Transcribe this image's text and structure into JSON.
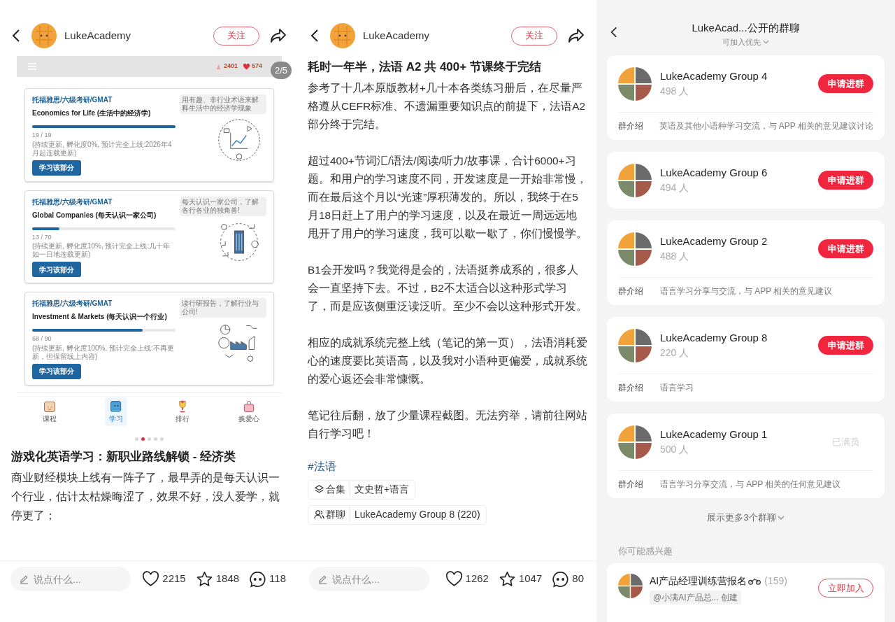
{
  "left": {
    "author": "LukeAcademy",
    "follow": "关注",
    "slide": {
      "counter": "2/5",
      "stats": [
        {
          "kind": "xp",
          "value": "2401"
        },
        {
          "kind": "heart",
          "value": "574"
        }
      ],
      "courses": [
        {
          "tag": "托福雅思/六级考研/GMAT",
          "title": "Economics for Life (生活中的经济学)",
          "bubble": "用有趣、非行业术语来解释生活中的经济学现象",
          "level": 1,
          "count": "19 / 19",
          "note": "(持续更新, 孵化度0%, 预计完全上线:2026年4月起连载更新)",
          "button": "学习该部分",
          "kind": "economy"
        },
        {
          "tag": "托福雅思/六级考研/GMAT",
          "title": "Global Companies (每天认识一家公司)",
          "bubble": "每天认识一家公司，了解各行各业的独角兽!",
          "level": 0.19,
          "count": "13 / 70",
          "note": "(持续更新, 孵化度10%, 预计完全上线:几十年如一日地连载更新)",
          "button": "学习该部分",
          "kind": "company"
        },
        {
          "tag": "托福雅思/六级考研/GMAT",
          "title": "Investment & Markets (每天认识一个行业)",
          "bubble": "读行研报告，了解行业与公司!",
          "level": 0.77,
          "count": "68 / 90",
          "note": "(持续更新, 孵化度100%, 预计完全上线:不再更新，但保留线上内容)",
          "button": "学习该部分",
          "kind": "industry"
        }
      ],
      "tabs": [
        {
          "label": "课程",
          "selected": false,
          "kind": "course"
        },
        {
          "label": "学习",
          "selected": true,
          "kind": "book"
        },
        {
          "label": "排行",
          "selected": false,
          "kind": "trophy"
        },
        {
          "label": "换爱心",
          "selected": false,
          "kind": "bag"
        }
      ]
    },
    "dots": [
      {
        "selected": false
      },
      {
        "selected": true
      },
      {
        "selected": false
      },
      {
        "selected": false
      },
      {
        "selected": false
      }
    ],
    "title": "游戏化英语学习：新职业路线解锁 - 经济类",
    "body": "商业财经模块上线有一阵子了，最早弄的是每天认识一个行业，估计太枯燥晦涩了，效果不好，没人爱学，就停更了；",
    "bar": {
      "placeholder": "说点什么...",
      "likes": "2215",
      "stars": "1848",
      "comments": "118"
    }
  },
  "middle": {
    "author": "LukeAcademy",
    "follow": "关注",
    "title": "耗时一年半，法语 A2 共 400+ 节课终于完结",
    "paragraphs": [
      "参考了十几本原版教材+几十本各类练习册后，在尽量严格遵从CEFR标准、不遗漏重要知识点的前提下，法语A2部分终于完结。",
      "超过400+节词汇/语法/阅读/听力/故事课，合计6000+习题。和用户的学习速度不同，开发速度是一开始非常慢，而在最后这个月以“光速”厚积薄发的。所以，我终于在5月18日赶上了用户的学习速度，以及在最近一周远远地甩开了用户的学习速度，我可以歇一歇了，你们慢慢学。",
      "B1会开发吗？我觉得是会的，法语挺养成系的，很多人会一直坚持下去。不过，B2不太适合以这种形式学习了，而是应该侧重泛读泛听。至少不会以这种形式开发。",
      "相应的成就系统完整上线（笔记的第一页），法语消耗爱心的速度要比英语高，以及我对小语种更偏爱，成就系统的爱心返还会非常慷慨。",
      "笔记往后翻，放了少量课程截图。无法穷举，请前往网站自行学习吧！"
    ],
    "hashtag": "#法语",
    "chips": [
      {
        "kind": "collection",
        "label": "合集",
        "value": "文史哲+语言"
      },
      {
        "kind": "group",
        "label": "群聊",
        "value": "LukeAcademy Group 8 (220)"
      }
    ],
    "bar": {
      "placeholder": "说点什么...",
      "likes": "1262",
      "stars": "1047",
      "comments": "80"
    }
  },
  "right": {
    "title": "LukeAcad...公开的群聊",
    "filter": "可加入优先",
    "groups": [
      {
        "name": "LukeAcademy Group 4",
        "members": "498 人",
        "kind": "join",
        "action": "申请进群",
        "intro_label": "群介绍",
        "intro": "英语及其他小语种学习交流，与 APP 相关的意见建议讨论"
      },
      {
        "name": "LukeAcademy Group 6",
        "members": "494 人",
        "kind": "join",
        "action": "申请进群"
      },
      {
        "name": "LukeAcademy Group 2",
        "members": "488 人",
        "kind": "join",
        "action": "申请进群",
        "intro_label": "群介绍",
        "intro": "语言学习分享与交流，与 APP 相关的意见建议"
      },
      {
        "name": "LukeAcademy Group 8",
        "members": "220 人",
        "kind": "join",
        "action": "申请进群",
        "intro_label": "群介绍",
        "intro": "语言学习"
      },
      {
        "name": "LukeAcademy Group 1",
        "members": "500 人",
        "kind": "full",
        "action": "已满员",
        "intro_label": "群介绍",
        "intro": "语言学习分享交流，与 APP 相关的任何意见建议"
      }
    ],
    "more": "展示更多3个群聊",
    "suggest_heading": "你可能感兴趣",
    "suggestion": {
      "name": "AI产品经理训练营报名",
      "count": "(159)",
      "creator": "@小满AI产品总... 创建",
      "action": "立即加入"
    }
  }
}
